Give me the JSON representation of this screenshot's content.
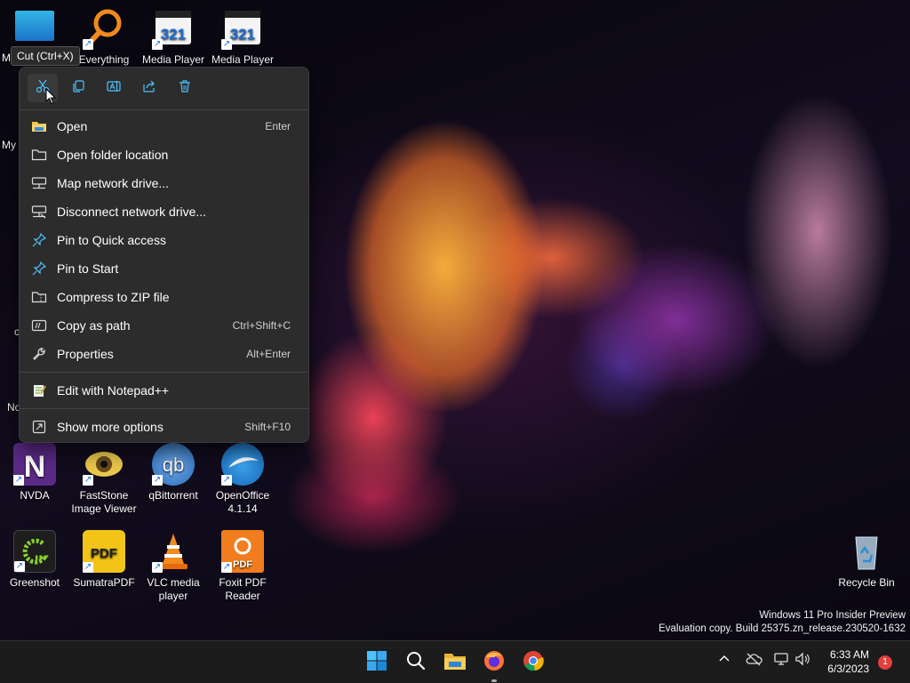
{
  "desktop": {
    "icons": [
      {
        "id": "everything",
        "label": "Everything"
      },
      {
        "id": "media-player-1",
        "label": "Media Player"
      },
      {
        "id": "media-player-2",
        "label": "Media Player"
      },
      {
        "id": "nvda",
        "label": "NVDA"
      },
      {
        "id": "faststone",
        "label": "FastStone Image Viewer"
      },
      {
        "id": "qbittorrent",
        "label": "qBittorrent"
      },
      {
        "id": "openoffice",
        "label": "OpenOffice 4.1.14"
      },
      {
        "id": "greenshot",
        "label": "Greenshot"
      },
      {
        "id": "sumatrapdf",
        "label": "SumatraPDF"
      },
      {
        "id": "vlc",
        "label": "VLC media player"
      },
      {
        "id": "foxit",
        "label": "Foxit PDF Reader"
      },
      {
        "id": "recycle-bin",
        "label": "Recycle Bin"
      }
    ],
    "partial_labels": {
      "my1": "M",
      "my2": "My",
      "c": "c",
      "no": "No"
    },
    "watermark": {
      "line1": "Windows 11 Pro Insider Preview",
      "line2": "Evaluation copy. Build 25375.zn_release.230520-1632"
    }
  },
  "tooltip": "Cut (Ctrl+X)",
  "context_menu": {
    "toolbar": [
      {
        "name": "cut",
        "icon": "scissors-icon"
      },
      {
        "name": "copy",
        "icon": "copy-icon"
      },
      {
        "name": "rename",
        "icon": "rename-icon"
      },
      {
        "name": "share",
        "icon": "share-icon"
      },
      {
        "name": "delete",
        "icon": "trash-icon"
      }
    ],
    "items": [
      {
        "label": "Open",
        "shortcut": "Enter",
        "icon": "folder-icon"
      },
      {
        "label": "Open folder location",
        "shortcut": "",
        "icon": "folder-outline-icon"
      },
      {
        "label": "Map network drive...",
        "shortcut": "",
        "icon": "network-drive-icon"
      },
      {
        "label": "Disconnect network drive...",
        "shortcut": "",
        "icon": "disconnect-drive-icon"
      },
      {
        "label": "Pin to Quick access",
        "shortcut": "",
        "icon": "pin-icon"
      },
      {
        "label": "Pin to Start",
        "shortcut": "",
        "icon": "pin-icon"
      },
      {
        "label": "Compress to ZIP file",
        "shortcut": "",
        "icon": "zip-icon"
      },
      {
        "label": "Copy as path",
        "shortcut": "Ctrl+Shift+C",
        "icon": "copy-path-icon"
      },
      {
        "label": "Properties",
        "shortcut": "Alt+Enter",
        "icon": "wrench-icon"
      },
      {
        "label": "Edit with Notepad++",
        "shortcut": "",
        "icon": "notepadpp-icon"
      },
      {
        "label": "Show more options",
        "shortcut": "Shift+F10",
        "icon": "more-options-icon"
      }
    ]
  },
  "taskbar": {
    "apps": [
      "start",
      "search",
      "file-explorer",
      "firefox",
      "chrome"
    ],
    "clock": {
      "time": "6:33 AM",
      "date": "6/3/2023"
    },
    "notification_count": "1"
  },
  "colors": {
    "menu_bg": "#2c2c2c",
    "taskbar_bg": "#1c1c1c",
    "accent": "#4cc2ff",
    "notification": "#e1413d"
  }
}
